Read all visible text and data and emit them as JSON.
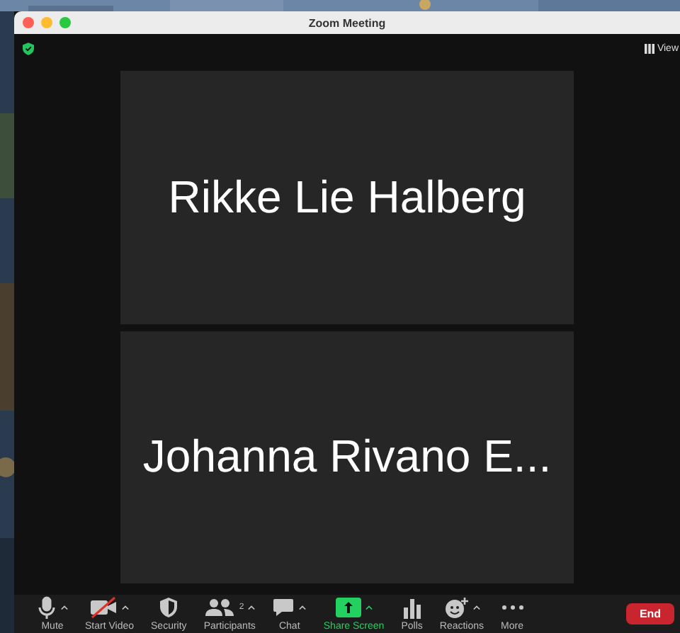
{
  "window": {
    "title": "Zoom Meeting"
  },
  "view_button": {
    "label": "View"
  },
  "tiles": [
    {
      "name": "Rikke Lie Halberg"
    },
    {
      "name": "Johanna Rivano E..."
    }
  ],
  "toolbar": [
    {
      "kind": "mic",
      "label": "Mute",
      "caret": true,
      "active": false
    },
    {
      "kind": "video-off",
      "label": "Start Video",
      "caret": true,
      "active": false
    },
    {
      "kind": "shield",
      "label": "Security",
      "caret": false,
      "active": false
    },
    {
      "kind": "people",
      "label": "Participants",
      "count": "2",
      "caret": true,
      "active": false
    },
    {
      "kind": "chat",
      "label": "Chat",
      "caret": true,
      "active": false
    },
    {
      "kind": "share",
      "label": "Share Screen",
      "caret": true,
      "active": true
    },
    {
      "kind": "polls",
      "label": "Polls",
      "caret": false,
      "active": false
    },
    {
      "kind": "reactions",
      "label": "Reactions",
      "caret": true,
      "active": false
    },
    {
      "kind": "more",
      "label": "More",
      "caret": false,
      "active": false
    }
  ],
  "end_button": {
    "label": "End"
  }
}
